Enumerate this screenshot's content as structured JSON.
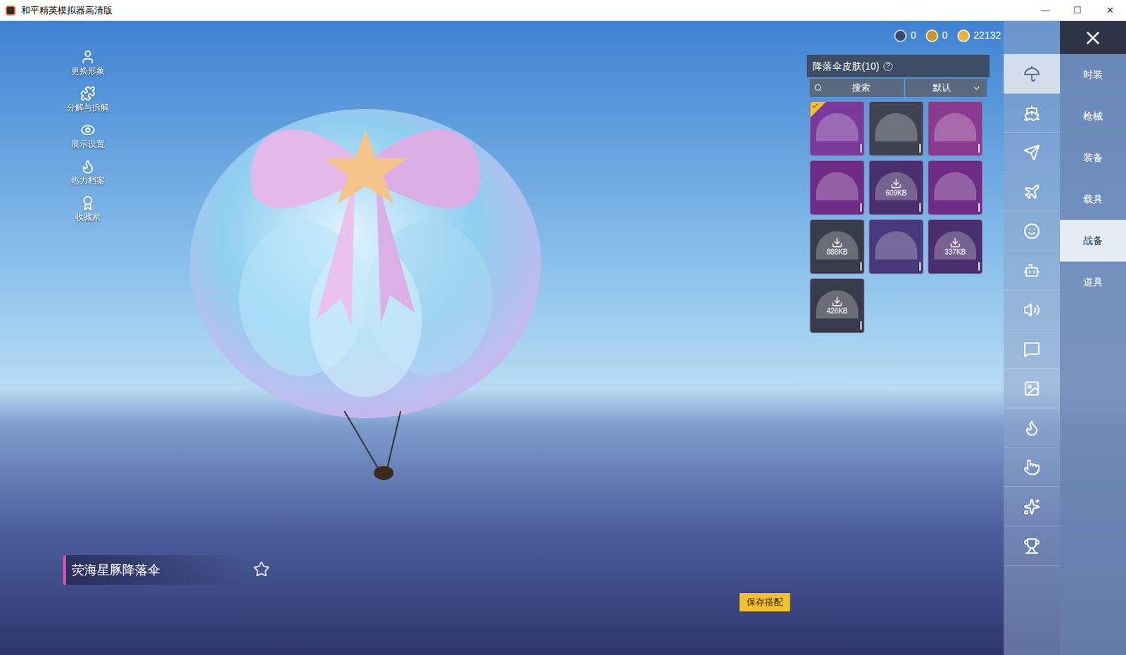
{
  "window": {
    "title": "和平精英模拟器高清版",
    "controls": [
      "—",
      "☐",
      "✕"
    ]
  },
  "side_menu": [
    {
      "label": "更换形象"
    },
    {
      "label": "分解与拆解"
    },
    {
      "label": "展示设置"
    },
    {
      "label": "热力档案"
    },
    {
      "label": "收藏家"
    }
  ],
  "currency": [
    {
      "amount": "0",
      "color": "#3b4a6b"
    },
    {
      "amount": "0",
      "color": "#c9962b"
    },
    {
      "amount": "22132",
      "color": "#e7b43a"
    }
  ],
  "panel": {
    "title": "降落伞皮肤(10)",
    "help": "?",
    "search": {
      "placeholder": "搜索"
    },
    "sort": {
      "value": "默认"
    },
    "items": [
      {
        "kind": "ready",
        "selected": true,
        "color": "#7a3a9c"
      },
      {
        "kind": "ready",
        "selected": false,
        "color": "#3d4350"
      },
      {
        "kind": "ready",
        "selected": false,
        "color": "#8a3a8f"
      },
      {
        "kind": "ready",
        "selected": false,
        "color": "#6e2c86"
      },
      {
        "kind": "download",
        "size": "609KB",
        "selected": false,
        "color": "#4a2f6e"
      },
      {
        "kind": "ready",
        "selected": false,
        "color": "#6e2c86"
      },
      {
        "kind": "download",
        "size": "888KB",
        "selected": false,
        "color": "#383c4a"
      },
      {
        "kind": "ready",
        "selected": false,
        "color": "#48397a"
      },
      {
        "kind": "download",
        "size": "337KB",
        "selected": false,
        "color": "#4a2f6e"
      },
      {
        "kind": "download",
        "size": "426KB",
        "selected": false,
        "color": "#383c4a"
      }
    ]
  },
  "icon_tabs": [
    {
      "selected": true
    },
    {
      "selected": false
    },
    {
      "selected": false
    },
    {
      "selected": false
    },
    {
      "selected": false
    },
    {
      "selected": false
    },
    {
      "selected": false
    },
    {
      "selected": false
    },
    {
      "selected": false
    },
    {
      "selected": false
    },
    {
      "selected": false
    },
    {
      "selected": false
    },
    {
      "selected": false
    }
  ],
  "categories": [
    {
      "label": "时装",
      "selected": false
    },
    {
      "label": "枪械",
      "selected": false
    },
    {
      "label": "装备",
      "selected": false
    },
    {
      "label": "载具",
      "selected": false
    },
    {
      "label": "战备",
      "selected": true
    },
    {
      "label": "道具",
      "selected": false
    }
  ],
  "item_name": "荧海星豚降落伞",
  "save_button": "保存搭配"
}
